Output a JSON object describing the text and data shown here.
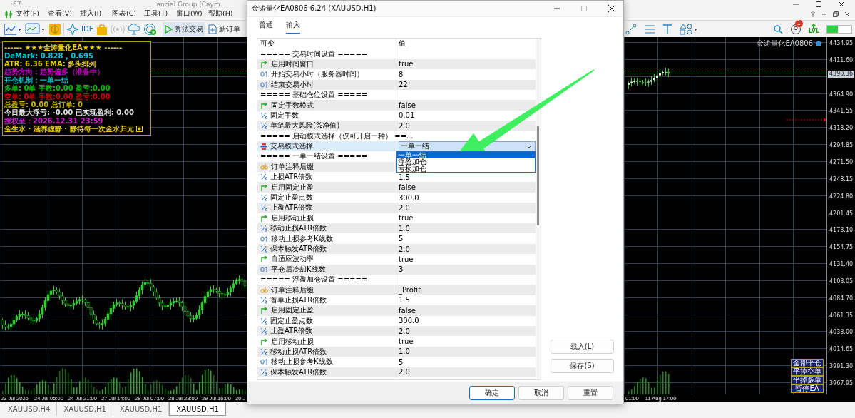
{
  "app": {
    "title_fragments": [
      "67",
      "ancial Group (Caym"
    ]
  },
  "menu": [
    "文件(F)",
    "查看(V)",
    "插入(I)",
    "图表(C)",
    "工具(T)",
    "窗口(W)",
    "帮助(H)"
  ],
  "toolbar": {
    "ide": "IDE",
    "algo_trading": {
      "label": "算法交易",
      "on": true
    },
    "new_order": "新订单",
    "notifications": "1",
    "lvl": "LVL"
  },
  "info_panel": {
    "lines": [
      {
        "text": "------ ★★★金涛量化EA★★★ ------",
        "color": "#e8d000"
      },
      {
        "text": "DeMark: 0.828 , 0.695",
        "color": "#00c8d8"
      },
      {
        "text": "ATR: 6.36  EMA: 多头排列",
        "color": "#e8d000"
      },
      {
        "text": "趋势方向：趋势偏多（准备中）",
        "color": "#c000c0"
      },
      {
        "text": "开仓机制：一单一结",
        "color": "#00c0c8"
      },
      {
        "text": "多单: 0单 手数:0.00 盈亏:0.00",
        "color": "#00c000"
      },
      {
        "text": "空单: 0单 手数:0.00 盈亏:0.00",
        "color": "#d00000"
      },
      {
        "text": "总盈亏: 0.00  总订单: 0",
        "color": "#c8b400"
      },
      {
        "text": "今日最大浮亏: -0.00  已实现盈利: 0.00",
        "color": "#e0e0e0"
      },
      {
        "text": "授权至：2026.12.31 23:59",
        "color": "#d020d0"
      },
      {
        "text": "金生水 · 涵养虚静 · 静待每一次金水归元",
        "color": "#e8d000"
      }
    ]
  },
  "chart": {
    "ea_label": "金涛量化EA0806",
    "current_price": "4390.36",
    "price_labels": [
      "4434.95",
      "4411.60",
      "4364.90",
      "4341.55",
      "4318.20",
      "4294.85",
      "4271.50",
      "4248.15",
      "4224.80",
      "4201.45",
      "4178.10",
      "4154.75",
      "4131.40",
      "4108.05",
      "4084.70",
      "4061.35",
      "4038.00",
      "4014.65",
      "3991.30",
      "3967.95"
    ],
    "time_labels_left": [
      "23 Jul 2026",
      "24 Jul 05:00",
      "24 Jul 21:00",
      "27 Jul 14:00",
      "28 Jul 07:00",
      "28 Jul 23:00",
      "29 Jul 16:00",
      "30 J"
    ],
    "time_labels_right": [
      "01:00",
      "11 Aug 17:00"
    ],
    "buttons": [
      "全部平仓",
      "平掉空单",
      "平掉多单",
      "暂停EA"
    ]
  },
  "chart_tabs": [
    {
      "label": "XAUUSD,H4",
      "selected": false
    },
    {
      "label": "XAUUSD,H1",
      "selected": false
    },
    {
      "label": "XAUUSD,H1",
      "selected": false
    },
    {
      "label": "XAUUSD,H1",
      "selected": true
    }
  ],
  "dialog": {
    "title": "金涛量化EA0806 6.24 (XAUUSD,H1)",
    "tabs": [
      {
        "label": "普通",
        "selected": false
      },
      {
        "label": "输入",
        "selected": true
      }
    ],
    "columns": [
      "可变",
      "值"
    ],
    "rows": [
      {
        "kind": "section",
        "name": "===== 交易时间设置 =====",
        "selected": false
      },
      {
        "kind": "bool",
        "name": "启用时间窗口",
        "value": "true",
        "selected": false
      },
      {
        "kind": "int",
        "name": "开始交易小时（服务器时间）",
        "value": "8",
        "selected": false
      },
      {
        "kind": "int",
        "name": "结束交易小时",
        "value": "22",
        "selected": false
      },
      {
        "kind": "section",
        "name": "===== 基础仓位设置 =====",
        "selected": false
      },
      {
        "kind": "bool",
        "name": "固定手数模式",
        "value": "false",
        "selected": false
      },
      {
        "kind": "double",
        "name": "固定手数",
        "value": "0.01",
        "selected": false
      },
      {
        "kind": "double",
        "name": "单笔最大风险(%净值)",
        "value": "2.0",
        "selected": false
      },
      {
        "kind": "section",
        "name": "===== 启动模式选择（仅可开启一种） ==...",
        "selected": false
      },
      {
        "kind": "enum",
        "name": "交易模式选择",
        "value": "一单一结",
        "selected": true,
        "options": [
          {
            "label": "一单一结",
            "selected": true
          },
          {
            "label": "浮盈加仓",
            "selected": false
          },
          {
            "label": "亏损加仓",
            "selected": false
          }
        ]
      },
      {
        "kind": "section",
        "name": "===== 一单一结设置 =====",
        "selected": false
      },
      {
        "kind": "string",
        "name": "订单注释后缀",
        "selected": false
      },
      {
        "kind": "double",
        "name": "止损ATR倍数",
        "value": "1.5",
        "selected": false
      },
      {
        "kind": "bool",
        "name": "启用固定止盈",
        "value": "false",
        "selected": false
      },
      {
        "kind": "double",
        "name": "固定止盈点数",
        "value": "300.0",
        "selected": false
      },
      {
        "kind": "double",
        "name": "止盈ATR倍数",
        "value": "2.0",
        "selected": false
      },
      {
        "kind": "bool",
        "name": "启用移动止损",
        "value": "true",
        "selected": false
      },
      {
        "kind": "double",
        "name": "移动止损ATR倍数",
        "value": "1.0",
        "selected": false
      },
      {
        "kind": "int",
        "name": "移动止损参考K线数",
        "value": "5",
        "selected": false
      },
      {
        "kind": "double",
        "name": "保本触发ATR倍数",
        "value": "2.0",
        "selected": false
      },
      {
        "kind": "bool",
        "name": "自适应波动率",
        "value": "true",
        "selected": false
      },
      {
        "kind": "int",
        "name": "平仓后冷却K线数",
        "value": "3",
        "selected": false
      },
      {
        "kind": "section",
        "name": "===== 浮盈加仓设置 =====",
        "selected": false
      },
      {
        "kind": "string",
        "name": "订单注释后缀",
        "value": "_Profit",
        "selected": false
      },
      {
        "kind": "double",
        "name": "首单止损ATR倍数",
        "value": "1.5",
        "selected": false
      },
      {
        "kind": "bool",
        "name": "启用固定止盈",
        "value": "false",
        "selected": false
      },
      {
        "kind": "double",
        "name": "固定止盈点数",
        "value": "300.0",
        "selected": false
      },
      {
        "kind": "double",
        "name": "止盈ATR倍数",
        "value": "2.0",
        "selected": false
      },
      {
        "kind": "bool",
        "name": "启用移动止损",
        "value": "true",
        "selected": false
      },
      {
        "kind": "double",
        "name": "移动止损ATR倍数",
        "value": "1.0",
        "selected": false
      },
      {
        "kind": "int",
        "name": "移动止损参考K线数",
        "value": "5",
        "selected": false
      },
      {
        "kind": "double",
        "name": "保本触发ATR倍数",
        "value": "2.0",
        "selected": false
      }
    ],
    "side_buttons": [
      "载入(L)",
      "保存(S)"
    ],
    "buttons": [
      {
        "label": "确定",
        "default": true
      },
      {
        "label": "取消",
        "default": false
      },
      {
        "label": "重置",
        "default": false
      }
    ]
  }
}
